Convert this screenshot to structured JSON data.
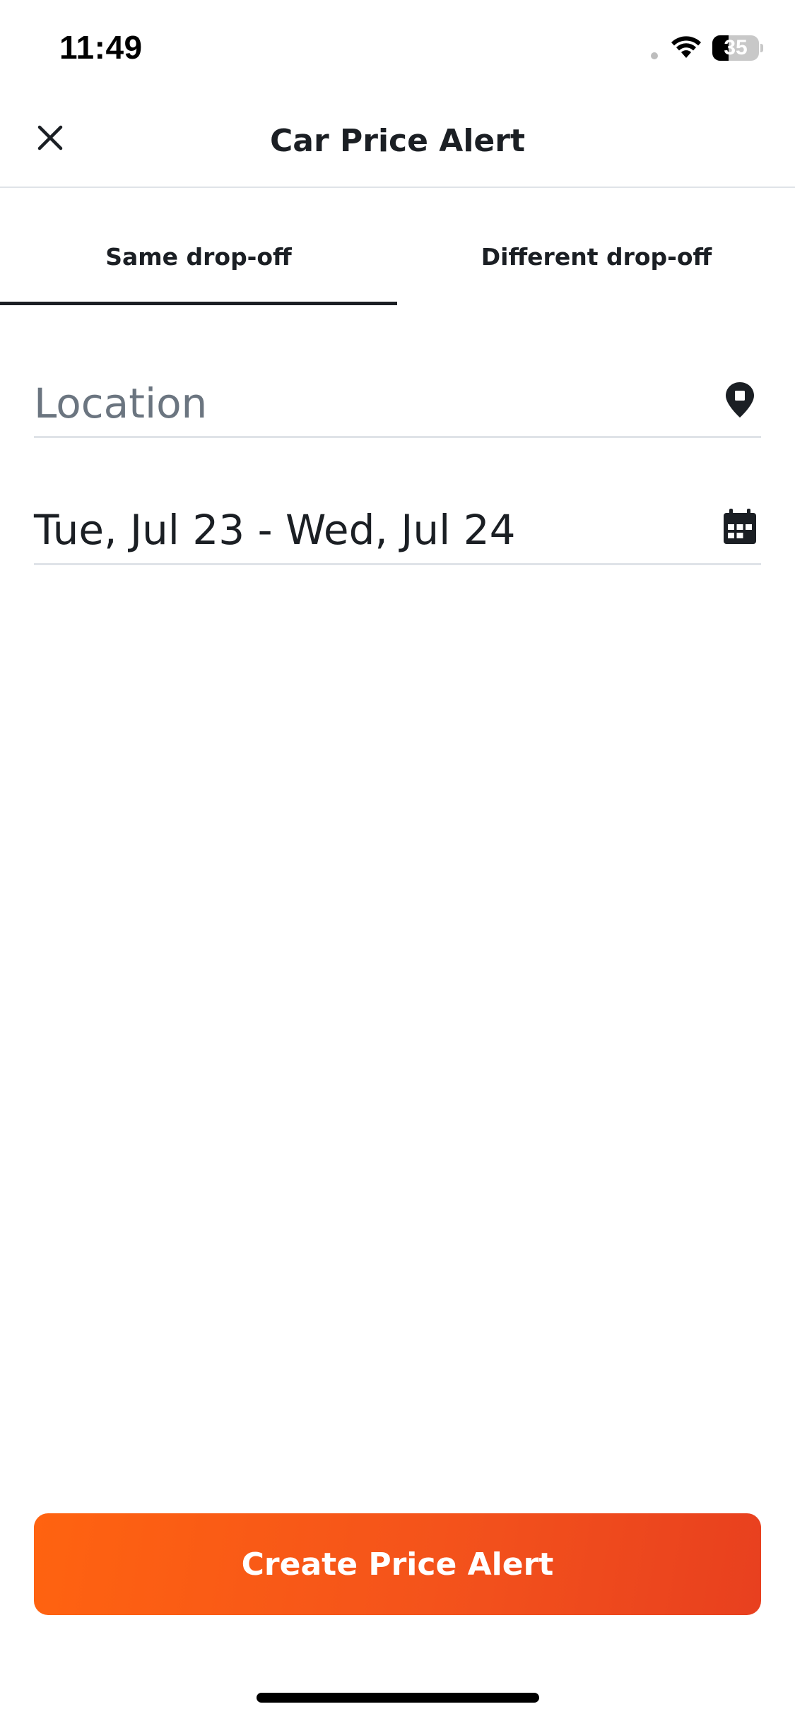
{
  "status_bar": {
    "time": "11:49",
    "battery_level": "35",
    "battery_fraction": 0.35
  },
  "header": {
    "title": "Car Price Alert",
    "close_icon": "close-icon"
  },
  "tabs": [
    {
      "label": "Same drop-off",
      "selected": true
    },
    {
      "label": "Different drop-off",
      "selected": false
    }
  ],
  "form": {
    "location": {
      "value": "",
      "placeholder": "Location",
      "icon": "location-pin-icon"
    },
    "dates": {
      "value": "Tue, Jul 23 - Wed, Jul 24",
      "icon": "calendar-icon"
    }
  },
  "actions": {
    "create_label": "Create Price Alert"
  },
  "colors": {
    "accent_start": "#ff6310",
    "accent_end": "#e8401f",
    "text_primary": "#1b1f24",
    "placeholder": "#6b7580",
    "divider": "#dfe3e8"
  }
}
